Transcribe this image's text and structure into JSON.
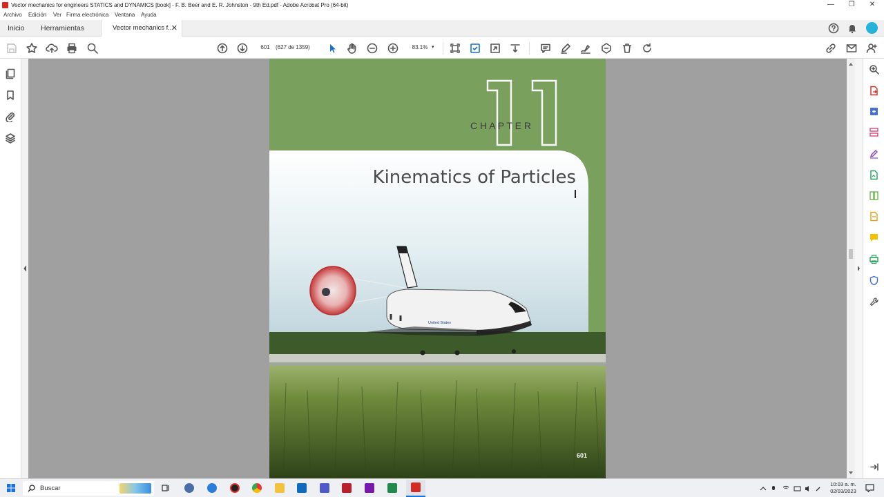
{
  "window": {
    "title": "Vector mechanics for engineers STATICS and DYNAMICS [book] - F. B. Beer and E. R. Johnston - 9th Ed.pdf - Adobe Acrobat Pro (64-bit)",
    "minimize": "—",
    "maximize": "❐",
    "close": "✕"
  },
  "menu": [
    "Archivo",
    "Edición",
    "Ver",
    "Firma electrónica",
    "Ventana",
    "Ayuda"
  ],
  "tabs": {
    "home": "Inicio",
    "tools": "Herramientas",
    "document": "Vector mechanics f...",
    "close": "✕"
  },
  "toolbar": {
    "page_number": "601",
    "page_count": "(627 de 1359)",
    "zoom": "83.1%",
    "zoom_caret": "▾"
  },
  "document": {
    "chapter_word": "C H A P T E R",
    "chapter_number": "11",
    "chapter_title": "Kinematics of Particles",
    "page_label": "601",
    "orbiter_text": "United States"
  },
  "taskbar": {
    "search": "Buscar",
    "time": "10:03 a. m.",
    "date": "02/03/2023"
  },
  "colors": {
    "chapter_band": "#7aa05e",
    "acrobat_red": "#d42a1f",
    "canvas_bg": "#a0a0a0"
  }
}
